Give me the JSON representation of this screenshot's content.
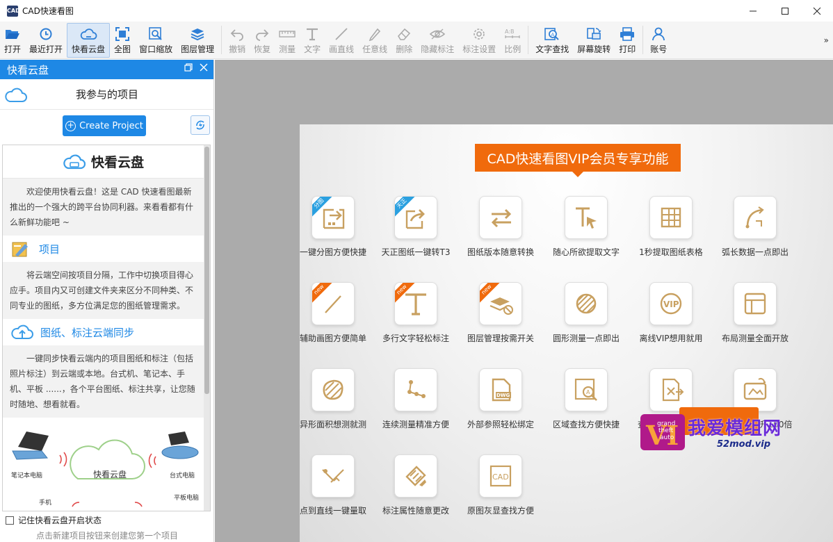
{
  "window": {
    "title": "CAD快速看图",
    "app_icon_text": "CAD",
    "controls": [
      "minimize",
      "maximize",
      "close"
    ]
  },
  "toolbar": {
    "items": [
      {
        "label": "打开",
        "icon": "folder-open-icon",
        "state": "normal"
      },
      {
        "label": "最近打开",
        "icon": "recent-clock-icon",
        "state": "normal"
      },
      {
        "label": "快看云盘",
        "icon": "cloud-icon",
        "state": "active"
      },
      {
        "label": "全图",
        "icon": "fit-all-icon",
        "state": "normal"
      },
      {
        "label": "窗口缩放",
        "icon": "zoom-window-icon",
        "state": "normal"
      },
      {
        "label": "图层管理",
        "icon": "layers-icon",
        "state": "normal"
      },
      {
        "label": "撤销",
        "icon": "undo-icon",
        "state": "disabled"
      },
      {
        "label": "恢复",
        "icon": "redo-icon",
        "state": "disabled"
      },
      {
        "label": "测量",
        "icon": "measure-icon",
        "state": "disabled"
      },
      {
        "label": "文字",
        "icon": "text-t-icon",
        "state": "disabled"
      },
      {
        "label": "画直线",
        "icon": "line-icon",
        "state": "disabled"
      },
      {
        "label": "任意线",
        "icon": "pen-icon",
        "state": "disabled"
      },
      {
        "label": "删除",
        "icon": "eraser-icon",
        "state": "disabled"
      },
      {
        "label": "隐藏标注",
        "icon": "eye-hide-icon",
        "state": "disabled"
      },
      {
        "label": "标注设置",
        "icon": "gear-icon",
        "state": "disabled"
      },
      {
        "label": "比例",
        "icon": "scale-ab-icon",
        "state": "disabled"
      },
      {
        "label": "文字查找",
        "icon": "text-search-icon",
        "state": "normal"
      },
      {
        "label": "屏幕旋转",
        "icon": "screen-rotate-icon",
        "state": "normal"
      },
      {
        "label": "打印",
        "icon": "printer-icon",
        "state": "normal"
      },
      {
        "label": "账号",
        "icon": "user-icon",
        "state": "normal"
      }
    ],
    "more": "»"
  },
  "panel": {
    "title": "快看云盘",
    "my_projects": "我参与的项目",
    "create_button": "Create Project",
    "intro": {
      "title": "快看云盘",
      "welcome": "欢迎使用快看云盘！这是 CAD 快速看图最新推出的一个强大的跨平台协同利器。来看看都有什么新鲜功能吧 ~",
      "sections": [
        {
          "title": "项目",
          "icon": "project-icon",
          "text": "将云端空间按项目分隔，工作中切换项目得心应手。项目内又可创建文件夹来区分不同种类、不同专业的图纸，多方位满足您的图纸管理需求。"
        },
        {
          "title": "图纸、标注云端同步",
          "icon": "cloud-upload-icon",
          "text": "一键同步快看云端内的项目图纸和标注（包括照片标注）到云端或本地。台式机、笔记本、手机、平板 ......，各个平台图纸、标注共享，让您随时随地、想看就看。"
        }
      ],
      "illustration": {
        "cloud_label": "快看云盘",
        "devices": [
          "笔记本电脑",
          "台式电脑",
          "手机",
          "平板电脑"
        ]
      }
    },
    "remember_label": "记住快看云盘开启状态",
    "remember_checked": false,
    "hint": "点击新建项目按钮来创建您第一个项目"
  },
  "promo": {
    "banner": "CAD快速看图VIP会员专享功能",
    "features": [
      {
        "label": "一键分图方便快捷",
        "icon": "split-export-icon",
        "ribbon": "分图",
        "ribbon_color": "#2aa0e0"
      },
      {
        "label": "天正图纸一键转T3",
        "icon": "convert-export-icon",
        "ribbon": "天正",
        "ribbon_color": "#2aa0e0"
      },
      {
        "label": "图纸版本随意转换",
        "icon": "swap-arrows-icon",
        "ribbon": "",
        "ribbon_color": ""
      },
      {
        "label": "随心所欲提取文字",
        "icon": "text-cursor-icon",
        "ribbon": "",
        "ribbon_color": ""
      },
      {
        "label": "1秒提取图纸表格",
        "icon": "table-grid-icon",
        "ribbon": "",
        "ribbon_color": ""
      },
      {
        "label": "弧长数据一点即出",
        "icon": "arc-length-icon",
        "ribbon": "",
        "ribbon_color": ""
      },
      {
        "label": "辅助画图方便简单",
        "icon": "slash-line-icon",
        "ribbon": "new",
        "ribbon_color": "#f06a0c"
      },
      {
        "label": "多行文字轻松标注",
        "icon": "multiline-text-icon",
        "ribbon": "new",
        "ribbon_color": "#f06a0c"
      },
      {
        "label": "图层管理按需开关",
        "icon": "layer-toggle-icon",
        "ribbon": "new",
        "ribbon_color": "#f06a0c"
      },
      {
        "label": "圆形测量一点即出",
        "icon": "circle-hatch-icon",
        "ribbon": "",
        "ribbon_color": ""
      },
      {
        "label": "离线VIP想用就用",
        "icon": "vip-badge-icon",
        "ribbon": "",
        "ribbon_color": ""
      },
      {
        "label": "布局测量全面开放",
        "icon": "layout-panel-icon",
        "ribbon": "",
        "ribbon_color": ""
      },
      {
        "label": "异形面积想测就测",
        "icon": "blob-area-icon",
        "ribbon": "",
        "ribbon_color": ""
      },
      {
        "label": "连续测量精准方便",
        "icon": "polyline-points-icon",
        "ribbon": "",
        "ribbon_color": ""
      },
      {
        "label": "外部参照轻松绑定",
        "icon": "dwg-file-icon",
        "ribbon": "",
        "ribbon_color": ""
      },
      {
        "label": "区域查找方便快捷",
        "icon": "area-search-icon",
        "ribbon": "",
        "ribbon_color": ""
      },
      {
        "label": "查找结果一键导出",
        "icon": "export-file-icon",
        "ribbon": "",
        "ribbon_color": ""
      },
      {
        "label": "云盘容量提升100倍",
        "icon": "cloud-folder-icon",
        "ribbon": "",
        "ribbon_color": ""
      },
      {
        "label": "点到直线一键量取",
        "icon": "point-line-icon",
        "ribbon": "",
        "ribbon_color": ""
      },
      {
        "label": "标注属性随意更改",
        "icon": "edit-annotation-icon",
        "ribbon": "",
        "ribbon_color": ""
      },
      {
        "label": "原图灰显查找方便",
        "icon": "cad-gray-icon",
        "ribbon": "",
        "ribbon_color": ""
      }
    ]
  },
  "watermark": {
    "text": "我爱模组网",
    "sub": "52mod.vip",
    "logo": "grand theft auto VI"
  },
  "colors": {
    "accent": "#1e88e5",
    "promo_orange": "#f06a0c",
    "icon_gold": "#c8a060",
    "canvas_gray": "#ababab"
  }
}
